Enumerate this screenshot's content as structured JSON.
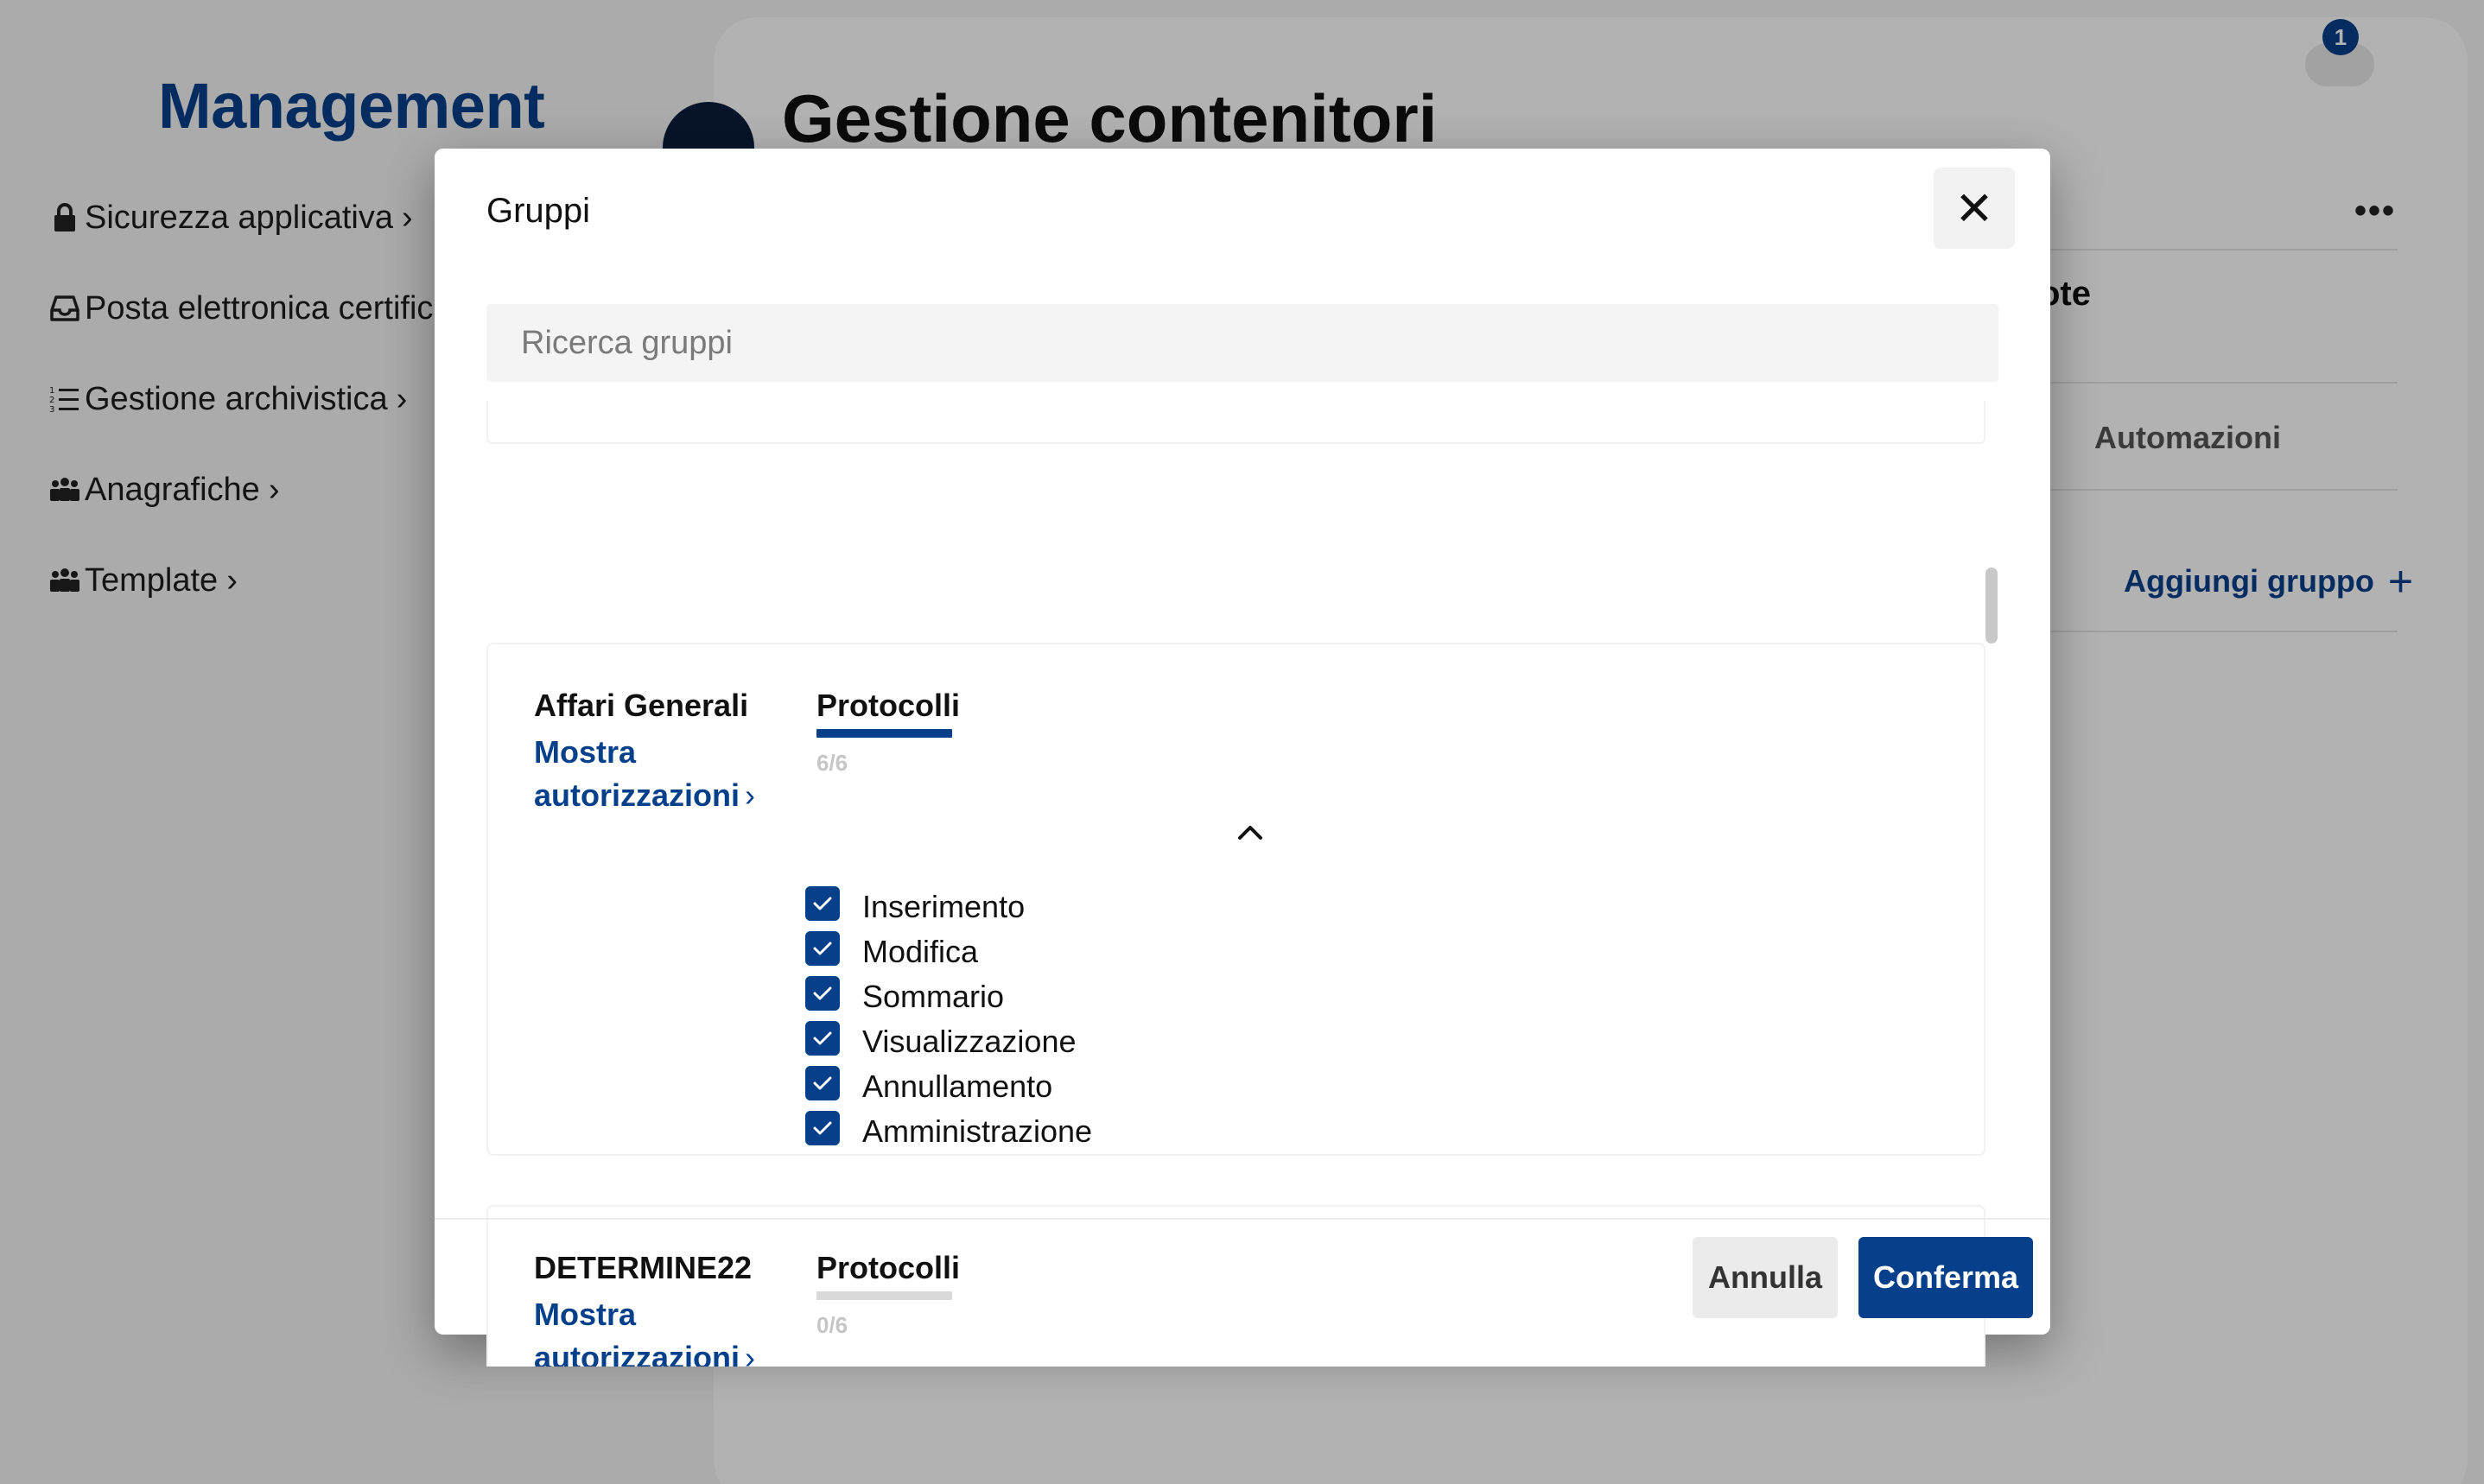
{
  "sidebar": {
    "title": "Management",
    "items": [
      {
        "label": "Sicurezza applicativa",
        "icon": "lock-icon"
      },
      {
        "label": "Posta elettronica certificata",
        "icon": "inbox-icon"
      },
      {
        "label": "Gestione archivistica",
        "icon": "numbered-list-icon"
      },
      {
        "label": "Anagrafiche",
        "icon": "people-icon"
      },
      {
        "label": "Template",
        "icon": "people-icon"
      }
    ]
  },
  "header": {
    "title": "Gestione contenitori",
    "notification_count": "1"
  },
  "background": {
    "partial_heading": "ote",
    "tab_automazioni": "Automazioni",
    "add_group": "Aggiungi gruppo"
  },
  "modal": {
    "title": "Gruppi",
    "search_placeholder": "Ricerca gruppi",
    "groups": [
      {
        "name": "Affari Generali",
        "show_auth": "Mostra autorizzazioni",
        "category": "Protocolli",
        "count": "6/6",
        "progress": 1.0,
        "expanded": true,
        "permissions": [
          {
            "label": "Inserimento",
            "checked": true
          },
          {
            "label": "Modifica",
            "checked": true
          },
          {
            "label": "Sommario",
            "checked": true
          },
          {
            "label": "Visualizzazione",
            "checked": true
          },
          {
            "label": "Annullamento",
            "checked": true
          },
          {
            "label": "Amministrazione",
            "checked": true
          }
        ]
      },
      {
        "name": "DETERMINE22",
        "show_auth": "Mostra autorizzazioni",
        "category": "Protocolli",
        "count": "0/6",
        "progress": 0.0,
        "expanded": false
      }
    ],
    "cancel_label": "Annulla",
    "confirm_label": "Conferma"
  },
  "colors": {
    "brand": "#06408a",
    "progress_empty": "#d9d9d9"
  }
}
